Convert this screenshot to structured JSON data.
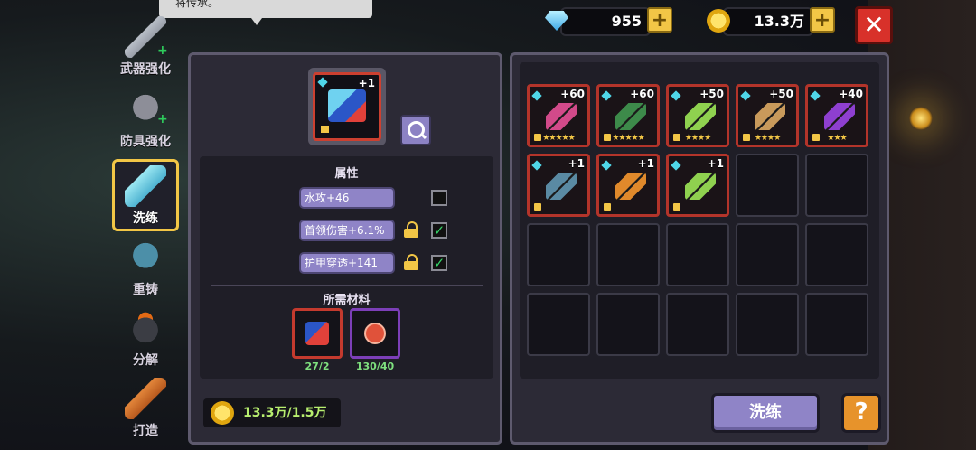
{
  "tooltip": {
    "text": "将传承。"
  },
  "currency": {
    "gems": "955",
    "coins": "13.3万"
  },
  "side_menu": [
    {
      "label": "武器强化"
    },
    {
      "label": "防具强化"
    },
    {
      "label": "洗练"
    },
    {
      "label": "重铸"
    },
    {
      "label": "分解"
    },
    {
      "label": "打造"
    }
  ],
  "selected_item": {
    "level": "+1"
  },
  "attributes": {
    "title": "属性",
    "rows": [
      {
        "label": "水攻+46",
        "locked": false,
        "checked": false
      },
      {
        "label": "首领伤害+6.1%",
        "locked": true,
        "checked": true
      },
      {
        "label": "护甲穿透+141",
        "locked": true,
        "checked": true
      }
    ]
  },
  "materials": {
    "title": "所需材料",
    "items": [
      {
        "count": "27/2",
        "color": "#c43a2e"
      },
      {
        "count": "130/40",
        "color": "#7c3fb8"
      }
    ]
  },
  "cost": {
    "text": "13.3万/1.5万"
  },
  "inventory": [
    {
      "level": "+60",
      "stars": "★★★★★",
      "color": "#d24a8a"
    },
    {
      "level": "+60",
      "stars": "★★★★★",
      "color": "#3d8a4a"
    },
    {
      "level": "+50",
      "stars": "★★★★",
      "color": "#8fd14f"
    },
    {
      "level": "+50",
      "stars": "★★★★",
      "color": "#c99a5b"
    },
    {
      "level": "+40",
      "stars": "★★★",
      "color": "#8e3fd0"
    },
    {
      "level": "+1",
      "stars": "",
      "color": "#5a8aa3"
    },
    {
      "level": "+1",
      "stars": "",
      "color": "#e0892b"
    },
    {
      "level": "+1",
      "stars": "",
      "color": "#8fd14f"
    }
  ],
  "buttons": {
    "wash": "洗练",
    "help": "?",
    "close": "✕"
  }
}
